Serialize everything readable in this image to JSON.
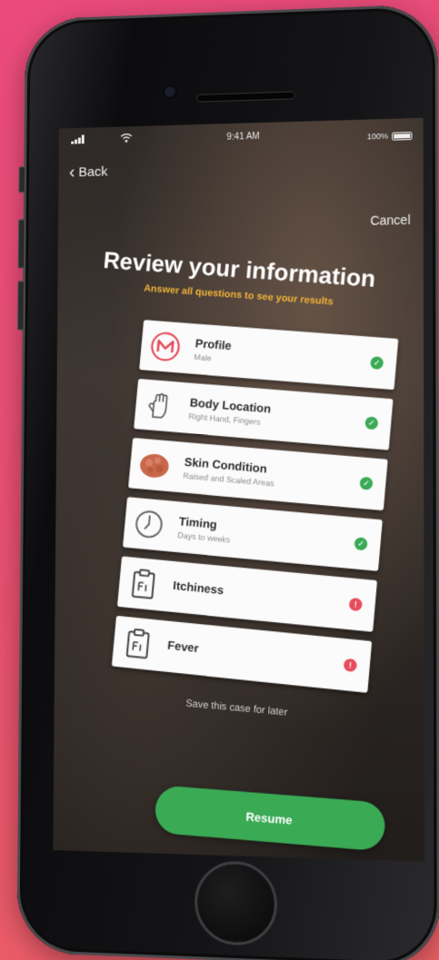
{
  "status_bar": {
    "time": "9:41 AM",
    "battery": "100%"
  },
  "nav": {
    "back_label": "Back",
    "cancel_label": "Cancel"
  },
  "page": {
    "title": "Review your information",
    "subtitle": "Answer all questions to see your results"
  },
  "items": [
    {
      "label": "Profile",
      "detail": "Male",
      "icon": "profile-logo-icon",
      "status": "complete"
    },
    {
      "label": "Body Location",
      "detail": "Right Hand, Fingers",
      "icon": "hand-icon",
      "status": "complete"
    },
    {
      "label": "Skin Condition",
      "detail": "Raised and Scaled Areas",
      "icon": "skin-condition-icon",
      "status": "complete"
    },
    {
      "label": "Timing",
      "detail": "Days to weeks",
      "icon": "clock-icon",
      "status": "complete"
    },
    {
      "label": "Itchiness",
      "detail": "",
      "icon": "clipboard-icon",
      "status": "incomplete"
    },
    {
      "label": "Fever",
      "detail": "",
      "icon": "clipboard-icon",
      "status": "incomplete"
    }
  ],
  "save_label": "Save this case for later",
  "resume_label": "Resume",
  "colors": {
    "background_pink": "#ea4a7c",
    "accent_yellow": "#f0b23a",
    "complete_green": "#3aaa55",
    "incomplete_red": "#e64c5a"
  }
}
